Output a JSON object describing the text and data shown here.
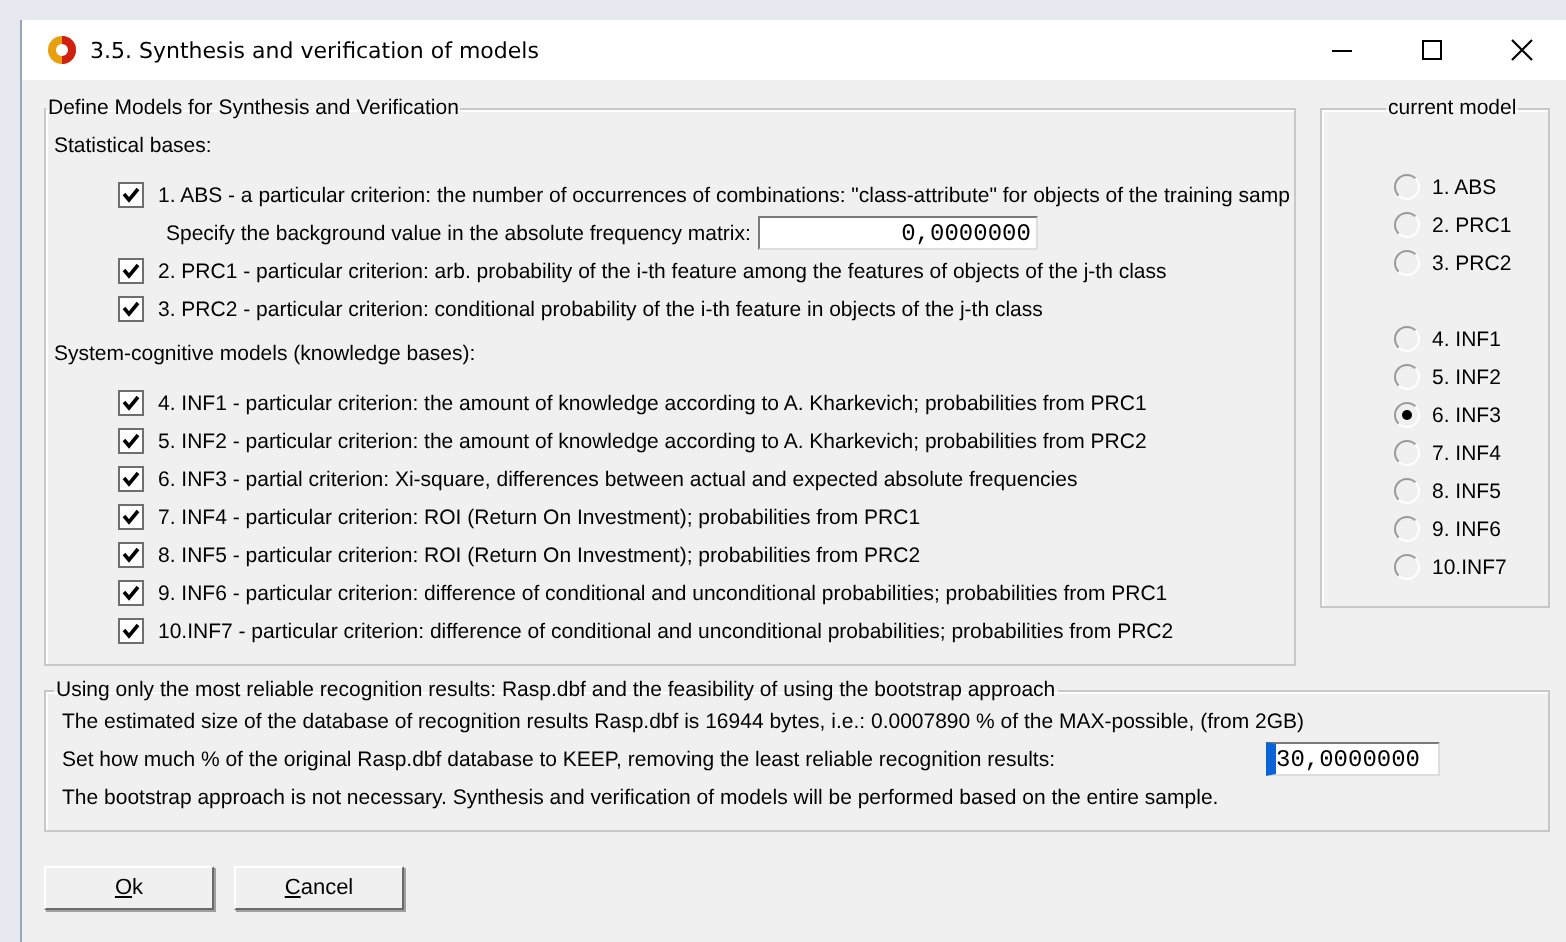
{
  "window": {
    "title": "3.5. Synthesis and verification of models"
  },
  "models_group": {
    "title": "Define Models for Synthesis and Verification",
    "sections": [
      {
        "heading": "Statistical bases:",
        "items": [
          {
            "kind": "checkbox",
            "label": "1. ABS - a particular criterion: the number of occurrences of combinations: \"class-attribute\" for objects of the training samp",
            "checked": true
          },
          {
            "kind": "field",
            "label": "Specify the background value in the absolute frequency matrix:",
            "value": "0,0000000"
          },
          {
            "kind": "checkbox",
            "label": "2. PRC1 - particular criterion: arb. probability of the i-th feature among the features of objects of the j-th class",
            "checked": true
          },
          {
            "kind": "checkbox",
            "label": "3. PRC2 - particular criterion: conditional probability of the i-th feature in objects of the j-th class",
            "checked": true
          }
        ]
      },
      {
        "heading": "System-cognitive models (knowledge bases):",
        "items": [
          {
            "kind": "checkbox",
            "label": "4. INF1 - particular criterion: the amount of knowledge according to A. Kharkevich; probabilities from PRC1",
            "checked": true
          },
          {
            "kind": "checkbox",
            "label": "5. INF2 - particular criterion: the amount of knowledge according to A. Kharkevich; probabilities from PRC2",
            "checked": true
          },
          {
            "kind": "checkbox",
            "label": "6. INF3 - partial criterion: Xi-square, differences between actual and expected absolute frequencies",
            "checked": true
          },
          {
            "kind": "checkbox",
            "label": "7. INF4 - particular criterion: ROI (Return On Investment); probabilities from PRC1",
            "checked": true
          },
          {
            "kind": "checkbox",
            "label": "8. INF5 - particular criterion: ROI (Return On Investment); probabilities from PRC2",
            "checked": true
          },
          {
            "kind": "checkbox",
            "label": "9. INF6 - particular criterion: difference of conditional and unconditional probabilities; probabilities from PRC1",
            "checked": true
          },
          {
            "kind": "checkbox",
            "label": "10.INF7 - particular criterion: difference of conditional and unconditional probabilities; probabilities from PRC2",
            "checked": true
          }
        ]
      }
    ]
  },
  "current_model": {
    "title": "current model",
    "groups": [
      [
        {
          "label": "1. ABS",
          "selected": false
        },
        {
          "label": "2. PRC1",
          "selected": false
        },
        {
          "label": "3. PRC2",
          "selected": false
        }
      ],
      [
        {
          "label": "4. INF1",
          "selected": false
        },
        {
          "label": "5. INF2",
          "selected": false
        },
        {
          "label": "6. INF3",
          "selected": true
        },
        {
          "label": "7. INF4",
          "selected": false
        },
        {
          "label": "8. INF5",
          "selected": false
        },
        {
          "label": "9. INF6",
          "selected": false
        },
        {
          "label": "10.INF7",
          "selected": false
        }
      ]
    ]
  },
  "reliability_group": {
    "title": "Using only the most reliable recognition results: Rasp.dbf and the feasibility of using the bootstrap approach",
    "lines": [
      {
        "kind": "text",
        "text": "The estimated size of the database of recognition results Rasp.dbf is 16944 bytes, i.e.: 0.0007890 % of the MAX-possible, (from 2GB)"
      },
      {
        "kind": "field",
        "label": "Set how much % of the original Rasp.dbf database to KEEP, removing the least reliable recognition results:",
        "value": "30,0000000",
        "focused": true
      },
      {
        "kind": "text",
        "text": "The bootstrap approach is not necessary. Synthesis and verification of models will be performed based on the entire sample."
      }
    ]
  },
  "buttons": [
    {
      "label": "Ok",
      "mnemonic": true
    },
    {
      "label": "Cancel",
      "mnemonic": true
    }
  ]
}
